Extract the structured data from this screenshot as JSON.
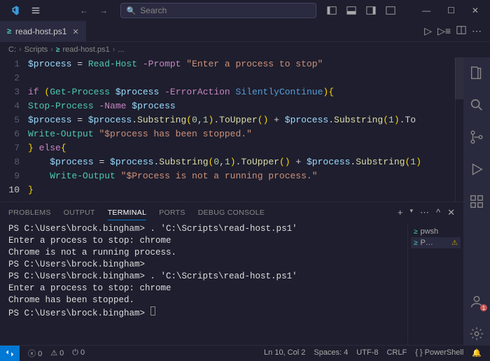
{
  "titlebar": {
    "search_placeholder": "Search"
  },
  "tab": {
    "filename": "read-host.ps1"
  },
  "breadcrumb": {
    "drive": "C:",
    "folder": "Scripts",
    "file": "read-host.ps1",
    "trailing": "..."
  },
  "code": {
    "lines": [
      {
        "n": 1,
        "indent": 0,
        "tokens": [
          [
            "var",
            "$process"
          ],
          [
            "op",
            " = "
          ],
          [
            "cmd",
            "Read-Host"
          ],
          [
            "op",
            " "
          ],
          [
            "param",
            "-Prompt"
          ],
          [
            "op",
            " "
          ],
          [
            "str",
            "\"Enter a process to stop\""
          ]
        ]
      },
      {
        "n": 2,
        "indent": 0,
        "tokens": []
      },
      {
        "n": 3,
        "indent": 0,
        "tokens": [
          [
            "kw",
            "if"
          ],
          [
            "op",
            " "
          ],
          [
            "brace",
            "("
          ],
          [
            "cmd",
            "Get-Process"
          ],
          [
            "op",
            " "
          ],
          [
            "var",
            "$process"
          ],
          [
            "op",
            " "
          ],
          [
            "param",
            "-ErrorAction"
          ],
          [
            "op",
            " "
          ],
          [
            "fn",
            "SilentlyContinue"
          ],
          [
            "brace",
            ")"
          ],
          [
            "brace",
            "{"
          ]
        ]
      },
      {
        "n": 4,
        "indent": 0,
        "tokens": [
          [
            "cmd",
            "Stop-Process"
          ],
          [
            "op",
            " "
          ],
          [
            "param",
            "-Name"
          ],
          [
            "op",
            " "
          ],
          [
            "var",
            "$process"
          ]
        ]
      },
      {
        "n": 5,
        "indent": 0,
        "tokens": [
          [
            "var",
            "$process"
          ],
          [
            "op",
            " = "
          ],
          [
            "var",
            "$process"
          ],
          [
            "punct",
            "."
          ],
          [
            "method",
            "Substring"
          ],
          [
            "brace",
            "("
          ],
          [
            "num",
            "0"
          ],
          [
            "punct",
            ","
          ],
          [
            "num",
            "1"
          ],
          [
            "brace",
            ")"
          ],
          [
            "punct",
            "."
          ],
          [
            "method",
            "ToUpper"
          ],
          [
            "brace",
            "()"
          ],
          [
            "op",
            " + "
          ],
          [
            "var",
            "$process"
          ],
          [
            "punct",
            "."
          ],
          [
            "method",
            "Substring"
          ],
          [
            "brace",
            "("
          ],
          [
            "num",
            "1"
          ],
          [
            "brace",
            ")"
          ],
          [
            "punct",
            ".To"
          ]
        ]
      },
      {
        "n": 6,
        "indent": 0,
        "tokens": [
          [
            "cmd",
            "Write-Output"
          ],
          [
            "op",
            " "
          ],
          [
            "str",
            "\"$process has been stopped.\""
          ]
        ]
      },
      {
        "n": 7,
        "indent": 0,
        "tokens": [
          [
            "brace",
            "}"
          ],
          [
            "op",
            " "
          ],
          [
            "kw",
            "else"
          ],
          [
            "brace",
            "{"
          ]
        ]
      },
      {
        "n": 8,
        "indent": 1,
        "tokens": [
          [
            "var",
            "$process"
          ],
          [
            "op",
            " = "
          ],
          [
            "var",
            "$process"
          ],
          [
            "punct",
            "."
          ],
          [
            "method",
            "Substring"
          ],
          [
            "brace",
            "("
          ],
          [
            "num",
            "0"
          ],
          [
            "punct",
            ","
          ],
          [
            "num",
            "1"
          ],
          [
            "brace",
            ")"
          ],
          [
            "punct",
            "."
          ],
          [
            "method",
            "ToUpper"
          ],
          [
            "brace",
            "()"
          ],
          [
            "op",
            " + "
          ],
          [
            "var",
            "$process"
          ],
          [
            "punct",
            "."
          ],
          [
            "method",
            "Substring"
          ],
          [
            "brace",
            "("
          ],
          [
            "num",
            "1"
          ],
          [
            "brace",
            ")"
          ]
        ]
      },
      {
        "n": 9,
        "indent": 1,
        "tokens": [
          [
            "cmd",
            "Write-Output"
          ],
          [
            "op",
            " "
          ],
          [
            "str",
            "\"$Process is not a running process.\""
          ]
        ]
      },
      {
        "n": 10,
        "indent": 0,
        "active": true,
        "tokens": [
          [
            "brace",
            "}"
          ]
        ]
      }
    ]
  },
  "panel": {
    "tabs": {
      "problems": "PROBLEMS",
      "output": "OUTPUT",
      "terminal": "TERMINAL",
      "ports": "PORTS",
      "debug": "DEBUG CONSOLE"
    },
    "terminal_lines": [
      "PS C:\\Users\\brock.bingham> . 'C:\\Scripts\\read-host.ps1'",
      "Enter a process to stop: chrome",
      "Chrome is not a running process.",
      "PS C:\\Users\\brock.bingham>",
      "PS C:\\Users\\brock.bingham> . 'C:\\Scripts\\read-host.ps1'",
      "Enter a process to stop: chrome",
      "Chrome has been stopped.",
      "PS C:\\Users\\brock.bingham> "
    ],
    "term_side": {
      "sess1": "pwsh",
      "sess2": "P…"
    }
  },
  "statusbar": {
    "errors": "0",
    "warnings": "0",
    "ports": "0",
    "position": "Ln 10, Col 2",
    "spaces": "Spaces: 4",
    "encoding": "UTF-8",
    "eol": "CRLF",
    "lang": "PowerShell"
  }
}
